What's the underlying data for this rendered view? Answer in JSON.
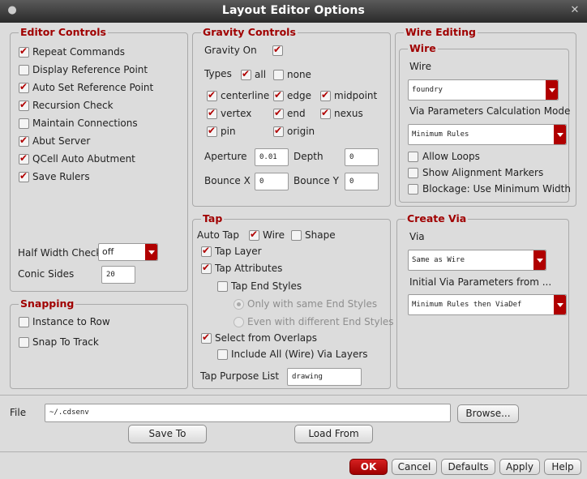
{
  "window": {
    "title": "Layout Editor Options"
  },
  "editor_controls": {
    "title": "Editor Controls",
    "items": [
      {
        "label": "Repeat Commands",
        "checked": true
      },
      {
        "label": "Display Reference Point",
        "checked": false
      },
      {
        "label": "Auto Set Reference Point",
        "checked": true
      },
      {
        "label": "Recursion Check",
        "checked": true
      },
      {
        "label": "Maintain Connections",
        "checked": false
      },
      {
        "label": "Abut Server",
        "checked": true
      },
      {
        "label": "QCell Auto Abutment",
        "checked": true
      },
      {
        "label": "Save Rulers",
        "checked": true
      }
    ],
    "half_width_label": "Half Width Check",
    "half_width_value": "off",
    "conic_label": "Conic Sides",
    "conic_value": "20"
  },
  "snapping": {
    "title": "Snapping",
    "instance_label": "Instance to Row",
    "snap_label": "Snap To Track"
  },
  "gravity": {
    "title": "Gravity Controls",
    "on_label": "Gravity On",
    "types_label": "Types",
    "all_label": "all",
    "none_label": "none",
    "types": [
      "centerline",
      "edge",
      "midpoint",
      "vertex",
      "end",
      "nexus",
      "pin",
      "origin"
    ],
    "aperture_label": "Aperture",
    "aperture_value": "0.01",
    "depth_label": "Depth",
    "depth_value": "0",
    "bounce_x_label": "Bounce X",
    "bounce_x_value": "0",
    "bounce_y_label": "Bounce Y",
    "bounce_y_value": "0"
  },
  "tap": {
    "title": "Tap",
    "auto_tap_label": "Auto Tap",
    "wire_label": "Wire",
    "shape_label": "Shape",
    "tap_layer_label": "Tap Layer",
    "tap_attributes_label": "Tap Attributes",
    "tap_end_styles_label": "Tap End Styles",
    "same_end_label": "Only with same End Styles",
    "diff_end_label": "Even with different End Styles",
    "select_overlaps_label": "Select from Overlaps",
    "include_all_label": "Include All (Wire) Via Layers",
    "purpose_label": "Tap Purpose List",
    "purpose_value": "drawing"
  },
  "wire_editing": {
    "title": "Wire Editing",
    "wire_group_title": "Wire",
    "wire_label": "Wire",
    "wire_value": "foundry",
    "via_calc_label": "Via Parameters Calculation Mode",
    "via_calc_value": "Minimum Rules",
    "allow_loops_label": "Allow Loops",
    "show_markers_label": "Show Alignment Markers",
    "blockage_label": "Blockage: Use Minimum Width"
  },
  "create_via": {
    "title": "Create Via",
    "via_label": "Via",
    "via_value": "Same as Wire",
    "initial_label": "Initial Via Parameters from ...",
    "initial_value": "Minimum Rules then ViaDef"
  },
  "file": {
    "label": "File",
    "value": "~/.cdsenv",
    "browse_label": "Browse...",
    "save_label": "Save To",
    "load_label": "Load From"
  },
  "footer": {
    "ok": "OK",
    "cancel": "Cancel",
    "defaults": "Defaults",
    "apply": "Apply",
    "help": "Help"
  },
  "colors": {
    "accent": "#b00000",
    "group_title": "#a00000",
    "titlebar": "#2a2a2a"
  }
}
